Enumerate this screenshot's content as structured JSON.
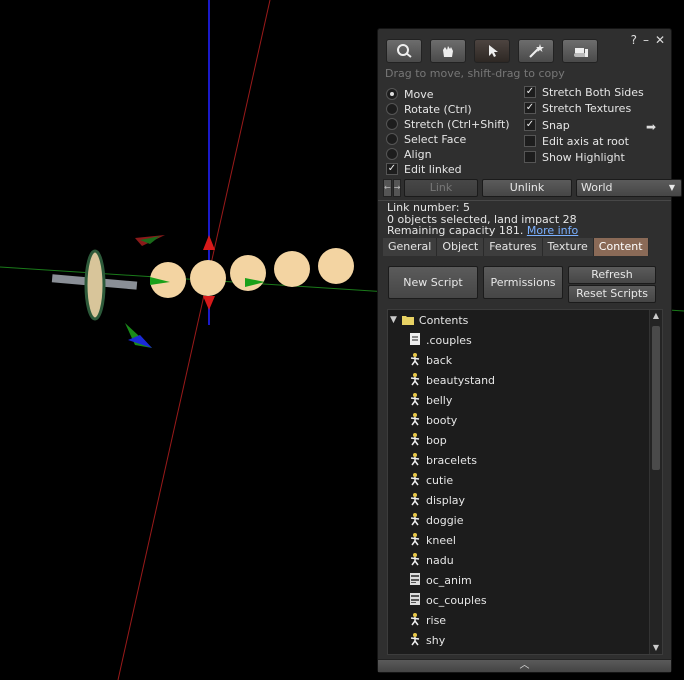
{
  "window_controls": {
    "help": "?",
    "minimize": "–",
    "close": "✕"
  },
  "toolbar": {
    "tools": [
      "focus",
      "move",
      "edit",
      "create",
      "land"
    ]
  },
  "hint": "Drag to move, shift-drag to copy",
  "modes": [
    {
      "label": "Move",
      "selected": true
    },
    {
      "label": "Rotate (Ctrl)",
      "selected": false
    },
    {
      "label": "Stretch (Ctrl+Shift)",
      "selected": false
    },
    {
      "label": "Select Face",
      "selected": false
    },
    {
      "label": "Align",
      "selected": false
    }
  ],
  "edit_linked": {
    "label": "Edit linked",
    "checked": true
  },
  "options": [
    {
      "label": "Stretch Both Sides",
      "checked": true
    },
    {
      "label": "Stretch Textures",
      "checked": true
    },
    {
      "label": "Snap",
      "checked": true
    },
    {
      "label": "Edit axis at root",
      "checked": false
    },
    {
      "label": "Show Highlight",
      "checked": false
    }
  ],
  "buttons": {
    "link": "Link",
    "unlink": "Unlink",
    "coord_select": "World"
  },
  "info": {
    "link_number": "Link number: 5",
    "selected": "0 objects selected, land impact 28",
    "capacity": "Remaining capacity 181.",
    "more_info": "More info"
  },
  "tabs": [
    "General",
    "Object",
    "Features",
    "Texture",
    "Content"
  ],
  "active_tab": "Content",
  "content": {
    "new_script": "New Script",
    "permissions": "Permissions",
    "refresh": "Refresh",
    "reset_scripts": "Reset Scripts",
    "folder": "Contents",
    "items": [
      {
        "name": ".couples",
        "icon": "notecard-icon"
      },
      {
        "name": "back",
        "icon": "animation-icon"
      },
      {
        "name": "beautystand",
        "icon": "animation-icon"
      },
      {
        "name": "belly",
        "icon": "animation-icon"
      },
      {
        "name": "booty",
        "icon": "animation-icon"
      },
      {
        "name": "bop",
        "icon": "animation-icon"
      },
      {
        "name": "bracelets",
        "icon": "animation-icon"
      },
      {
        "name": "cutie",
        "icon": "animation-icon"
      },
      {
        "name": "display",
        "icon": "animation-icon"
      },
      {
        "name": "doggie",
        "icon": "animation-icon"
      },
      {
        "name": "kneel",
        "icon": "animation-icon"
      },
      {
        "name": "nadu",
        "icon": "animation-icon"
      },
      {
        "name": "oc_anim",
        "icon": "script-icon"
      },
      {
        "name": "oc_couples",
        "icon": "script-icon"
      },
      {
        "name": "rise",
        "icon": "animation-icon"
      },
      {
        "name": "shy",
        "icon": "animation-icon"
      }
    ]
  },
  "colors": {
    "panel": "#2f2f2f",
    "active_tab": "#8a6a57",
    "link": "#7ab0ff"
  }
}
